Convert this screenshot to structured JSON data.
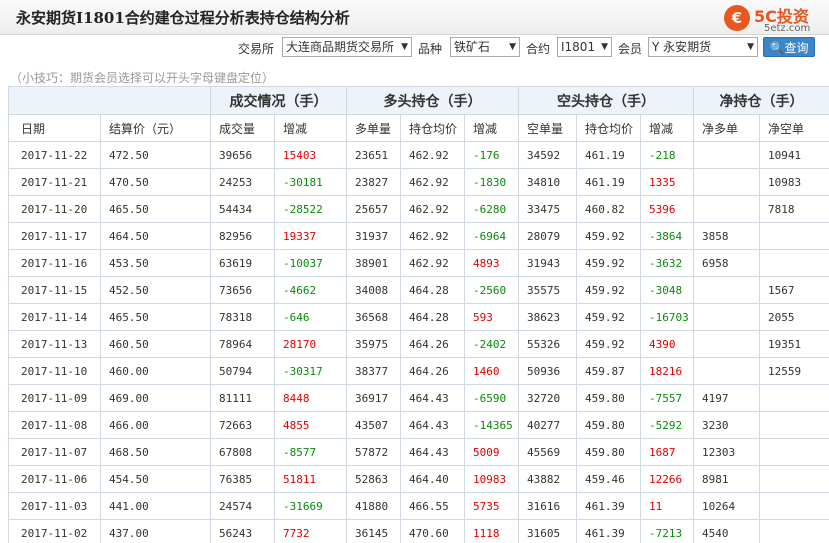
{
  "header": {
    "title": "永安期货I1801合约建仓过程分析表持仓结构分析",
    "logo_glyph": "€",
    "logo_brand": "5C投资",
    "logo_site": "5etz.com"
  },
  "filters": {
    "exchange_label": "交易所",
    "exchange_value": "大连商品期货交易所",
    "variety_label": "品种",
    "variety_value": "铁矿石",
    "contract_label": "合约",
    "contract_value": "I1801",
    "member_label": "会员",
    "member_value": "Y 永安期货",
    "query_button": "查询"
  },
  "tip": "（小技巧：期货会员选择可以开头字母键盘定位）",
  "table": {
    "group_headers": [
      "",
      "成交情况（手）",
      "多头持仓（手）",
      "空头持仓（手）",
      "净持仓（手）"
    ],
    "columns": [
      "日期",
      "结算价（元）",
      "成交量",
      "增减",
      "多单量",
      "持仓均价",
      "增减",
      "空单量",
      "持仓均价",
      "增减",
      "净多单",
      "净空单"
    ],
    "rows": [
      [
        "2017-11-22",
        "472.50",
        "39656",
        "15403",
        "23651",
        "462.92",
        "-176",
        "34592",
        "461.19",
        "-218",
        "",
        "10941"
      ],
      [
        "2017-11-21",
        "470.50",
        "24253",
        "-30181",
        "23827",
        "462.92",
        "-1830",
        "34810",
        "461.19",
        "1335",
        "",
        "10983"
      ],
      [
        "2017-11-20",
        "465.50",
        "54434",
        "-28522",
        "25657",
        "462.92",
        "-6280",
        "33475",
        "460.82",
        "5396",
        "",
        "7818"
      ],
      [
        "2017-11-17",
        "464.50",
        "82956",
        "19337",
        "31937",
        "462.92",
        "-6964",
        "28079",
        "459.92",
        "-3864",
        "3858",
        ""
      ],
      [
        "2017-11-16",
        "453.50",
        "63619",
        "-10037",
        "38901",
        "462.92",
        "4893",
        "31943",
        "459.92",
        "-3632",
        "6958",
        ""
      ],
      [
        "2017-11-15",
        "452.50",
        "73656",
        "-4662",
        "34008",
        "464.28",
        "-2560",
        "35575",
        "459.92",
        "-3048",
        "",
        "1567"
      ],
      [
        "2017-11-14",
        "465.50",
        "78318",
        "-646",
        "36568",
        "464.28",
        "593",
        "38623",
        "459.92",
        "-16703",
        "",
        "2055"
      ],
      [
        "2017-11-13",
        "460.50",
        "78964",
        "28170",
        "35975",
        "464.26",
        "-2402",
        "55326",
        "459.92",
        "4390",
        "",
        "19351"
      ],
      [
        "2017-11-10",
        "460.00",
        "50794",
        "-30317",
        "38377",
        "464.26",
        "1460",
        "50936",
        "459.87",
        "18216",
        "",
        "12559"
      ],
      [
        "2017-11-09",
        "469.00",
        "81111",
        "8448",
        "36917",
        "464.43",
        "-6590",
        "32720",
        "459.80",
        "-7557",
        "4197",
        ""
      ],
      [
        "2017-11-08",
        "466.00",
        "72663",
        "4855",
        "43507",
        "464.43",
        "-14365",
        "40277",
        "459.80",
        "-5292",
        "3230",
        ""
      ],
      [
        "2017-11-07",
        "468.50",
        "67808",
        "-8577",
        "57872",
        "464.43",
        "5009",
        "45569",
        "459.80",
        "1687",
        "12303",
        ""
      ],
      [
        "2017-11-06",
        "454.50",
        "76385",
        "51811",
        "52863",
        "464.40",
        "10983",
        "43882",
        "459.46",
        "12266",
        "8981",
        ""
      ],
      [
        "2017-11-03",
        "441.00",
        "24574",
        "-31669",
        "41880",
        "466.55",
        "5735",
        "31616",
        "461.39",
        "11",
        "10264",
        ""
      ],
      [
        "2017-11-02",
        "437.00",
        "56243",
        "7732",
        "36145",
        "470.60",
        "1118",
        "31605",
        "461.39",
        "-7213",
        "4540",
        ""
      ]
    ]
  },
  "colors": {
    "positive": "#e00000",
    "negative": "#0a8a0a",
    "header_bg": "#eef3fa",
    "brand": "#e8571e",
    "button": "#3b86c9"
  }
}
